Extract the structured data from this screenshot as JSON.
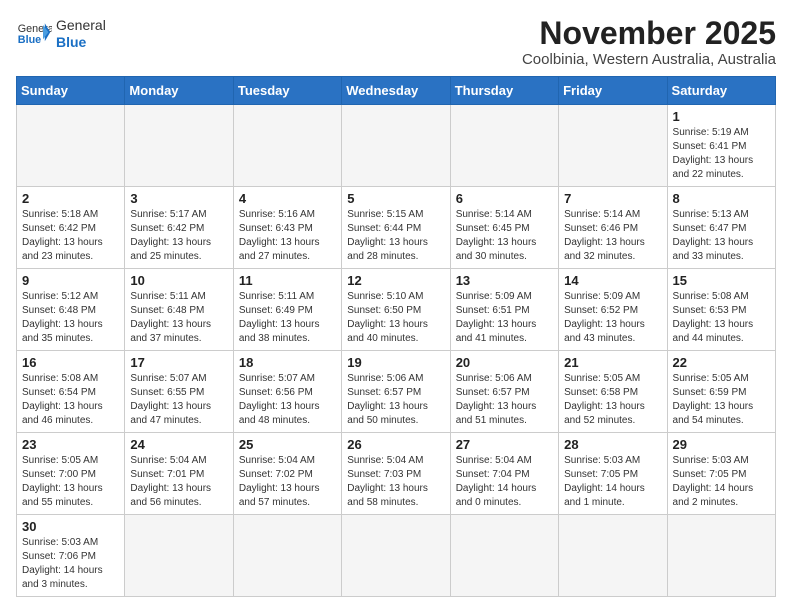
{
  "logo": {
    "general": "General",
    "blue": "Blue"
  },
  "title": "November 2025",
  "location": "Coolbinia, Western Australia, Australia",
  "weekdays": [
    "Sunday",
    "Monday",
    "Tuesday",
    "Wednesday",
    "Thursday",
    "Friday",
    "Saturday"
  ],
  "weeks": [
    [
      {
        "day": "",
        "info": ""
      },
      {
        "day": "",
        "info": ""
      },
      {
        "day": "",
        "info": ""
      },
      {
        "day": "",
        "info": ""
      },
      {
        "day": "",
        "info": ""
      },
      {
        "day": "",
        "info": ""
      },
      {
        "day": "1",
        "info": "Sunrise: 5:19 AM\nSunset: 6:41 PM\nDaylight: 13 hours\nand 22 minutes."
      }
    ],
    [
      {
        "day": "2",
        "info": "Sunrise: 5:18 AM\nSunset: 6:42 PM\nDaylight: 13 hours\nand 23 minutes."
      },
      {
        "day": "3",
        "info": "Sunrise: 5:17 AM\nSunset: 6:42 PM\nDaylight: 13 hours\nand 25 minutes."
      },
      {
        "day": "4",
        "info": "Sunrise: 5:16 AM\nSunset: 6:43 PM\nDaylight: 13 hours\nand 27 minutes."
      },
      {
        "day": "5",
        "info": "Sunrise: 5:15 AM\nSunset: 6:44 PM\nDaylight: 13 hours\nand 28 minutes."
      },
      {
        "day": "6",
        "info": "Sunrise: 5:14 AM\nSunset: 6:45 PM\nDaylight: 13 hours\nand 30 minutes."
      },
      {
        "day": "7",
        "info": "Sunrise: 5:14 AM\nSunset: 6:46 PM\nDaylight: 13 hours\nand 32 minutes."
      },
      {
        "day": "8",
        "info": "Sunrise: 5:13 AM\nSunset: 6:47 PM\nDaylight: 13 hours\nand 33 minutes."
      }
    ],
    [
      {
        "day": "9",
        "info": "Sunrise: 5:12 AM\nSunset: 6:48 PM\nDaylight: 13 hours\nand 35 minutes."
      },
      {
        "day": "10",
        "info": "Sunrise: 5:11 AM\nSunset: 6:48 PM\nDaylight: 13 hours\nand 37 minutes."
      },
      {
        "day": "11",
        "info": "Sunrise: 5:11 AM\nSunset: 6:49 PM\nDaylight: 13 hours\nand 38 minutes."
      },
      {
        "day": "12",
        "info": "Sunrise: 5:10 AM\nSunset: 6:50 PM\nDaylight: 13 hours\nand 40 minutes."
      },
      {
        "day": "13",
        "info": "Sunrise: 5:09 AM\nSunset: 6:51 PM\nDaylight: 13 hours\nand 41 minutes."
      },
      {
        "day": "14",
        "info": "Sunrise: 5:09 AM\nSunset: 6:52 PM\nDaylight: 13 hours\nand 43 minutes."
      },
      {
        "day": "15",
        "info": "Sunrise: 5:08 AM\nSunset: 6:53 PM\nDaylight: 13 hours\nand 44 minutes."
      }
    ],
    [
      {
        "day": "16",
        "info": "Sunrise: 5:08 AM\nSunset: 6:54 PM\nDaylight: 13 hours\nand 46 minutes."
      },
      {
        "day": "17",
        "info": "Sunrise: 5:07 AM\nSunset: 6:55 PM\nDaylight: 13 hours\nand 47 minutes."
      },
      {
        "day": "18",
        "info": "Sunrise: 5:07 AM\nSunset: 6:56 PM\nDaylight: 13 hours\nand 48 minutes."
      },
      {
        "day": "19",
        "info": "Sunrise: 5:06 AM\nSunset: 6:57 PM\nDaylight: 13 hours\nand 50 minutes."
      },
      {
        "day": "20",
        "info": "Sunrise: 5:06 AM\nSunset: 6:57 PM\nDaylight: 13 hours\nand 51 minutes."
      },
      {
        "day": "21",
        "info": "Sunrise: 5:05 AM\nSunset: 6:58 PM\nDaylight: 13 hours\nand 52 minutes."
      },
      {
        "day": "22",
        "info": "Sunrise: 5:05 AM\nSunset: 6:59 PM\nDaylight: 13 hours\nand 54 minutes."
      }
    ],
    [
      {
        "day": "23",
        "info": "Sunrise: 5:05 AM\nSunset: 7:00 PM\nDaylight: 13 hours\nand 55 minutes."
      },
      {
        "day": "24",
        "info": "Sunrise: 5:04 AM\nSunset: 7:01 PM\nDaylight: 13 hours\nand 56 minutes."
      },
      {
        "day": "25",
        "info": "Sunrise: 5:04 AM\nSunset: 7:02 PM\nDaylight: 13 hours\nand 57 minutes."
      },
      {
        "day": "26",
        "info": "Sunrise: 5:04 AM\nSunset: 7:03 PM\nDaylight: 13 hours\nand 58 minutes."
      },
      {
        "day": "27",
        "info": "Sunrise: 5:04 AM\nSunset: 7:04 PM\nDaylight: 14 hours\nand 0 minutes."
      },
      {
        "day": "28",
        "info": "Sunrise: 5:03 AM\nSunset: 7:05 PM\nDaylight: 14 hours\nand 1 minute."
      },
      {
        "day": "29",
        "info": "Sunrise: 5:03 AM\nSunset: 7:05 PM\nDaylight: 14 hours\nand 2 minutes."
      }
    ],
    [
      {
        "day": "30",
        "info": "Sunrise: 5:03 AM\nSunset: 7:06 PM\nDaylight: 14 hours\nand 3 minutes."
      },
      {
        "day": "",
        "info": ""
      },
      {
        "day": "",
        "info": ""
      },
      {
        "day": "",
        "info": ""
      },
      {
        "day": "",
        "info": ""
      },
      {
        "day": "",
        "info": ""
      },
      {
        "day": "",
        "info": ""
      }
    ]
  ]
}
